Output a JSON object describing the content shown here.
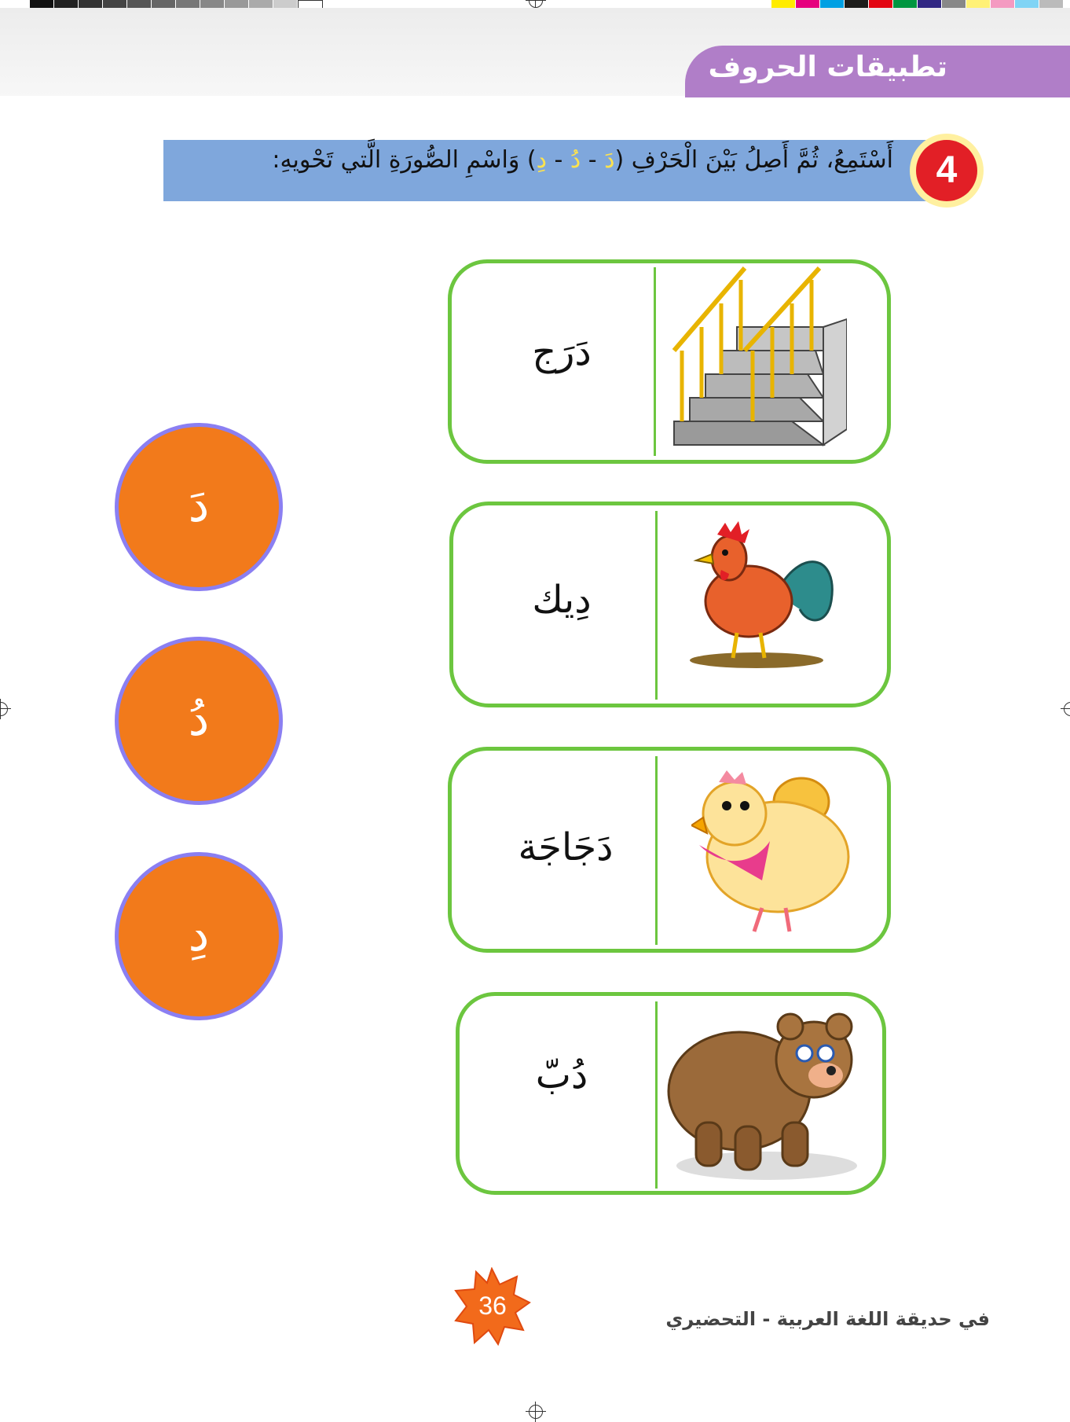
{
  "header": {
    "title": "تطبيقات الحروف"
  },
  "exercise": {
    "number": "4",
    "instruction_before": "أَسْتَمِعُ، ثُمَّ أَصِلُ بَيْنَ الْحَرْفِ (",
    "letter_fatha": "دَ",
    "sep1": " - ",
    "letter_damma": "دُ",
    "sep2": " - ",
    "letter_kasra": "دِ",
    "instruction_after": ") وَاسْمِ الصُّورَةِ الَّتي تَحْويهِ:"
  },
  "letters": [
    "دَ",
    "دُ",
    "دِ"
  ],
  "cards": [
    {
      "word": "دَرَج",
      "picture": "stairs-icon"
    },
    {
      "word": "دِيك",
      "picture": "rooster-icon"
    },
    {
      "word": "دَجَاجَة",
      "picture": "hen-icon"
    },
    {
      "word": "دُبّ",
      "picture": "bear-icon"
    }
  ],
  "footer": {
    "book_title": "في حديقة اللغة العربية - التحضيري",
    "page_number": "36"
  },
  "colors": {
    "card_border": "#6cc63f",
    "circle_fill": "#f27a1b",
    "circle_border": "#8b7ff2",
    "header_tab": "#b07ec8",
    "instruction_bar": "#7fa7dc"
  }
}
